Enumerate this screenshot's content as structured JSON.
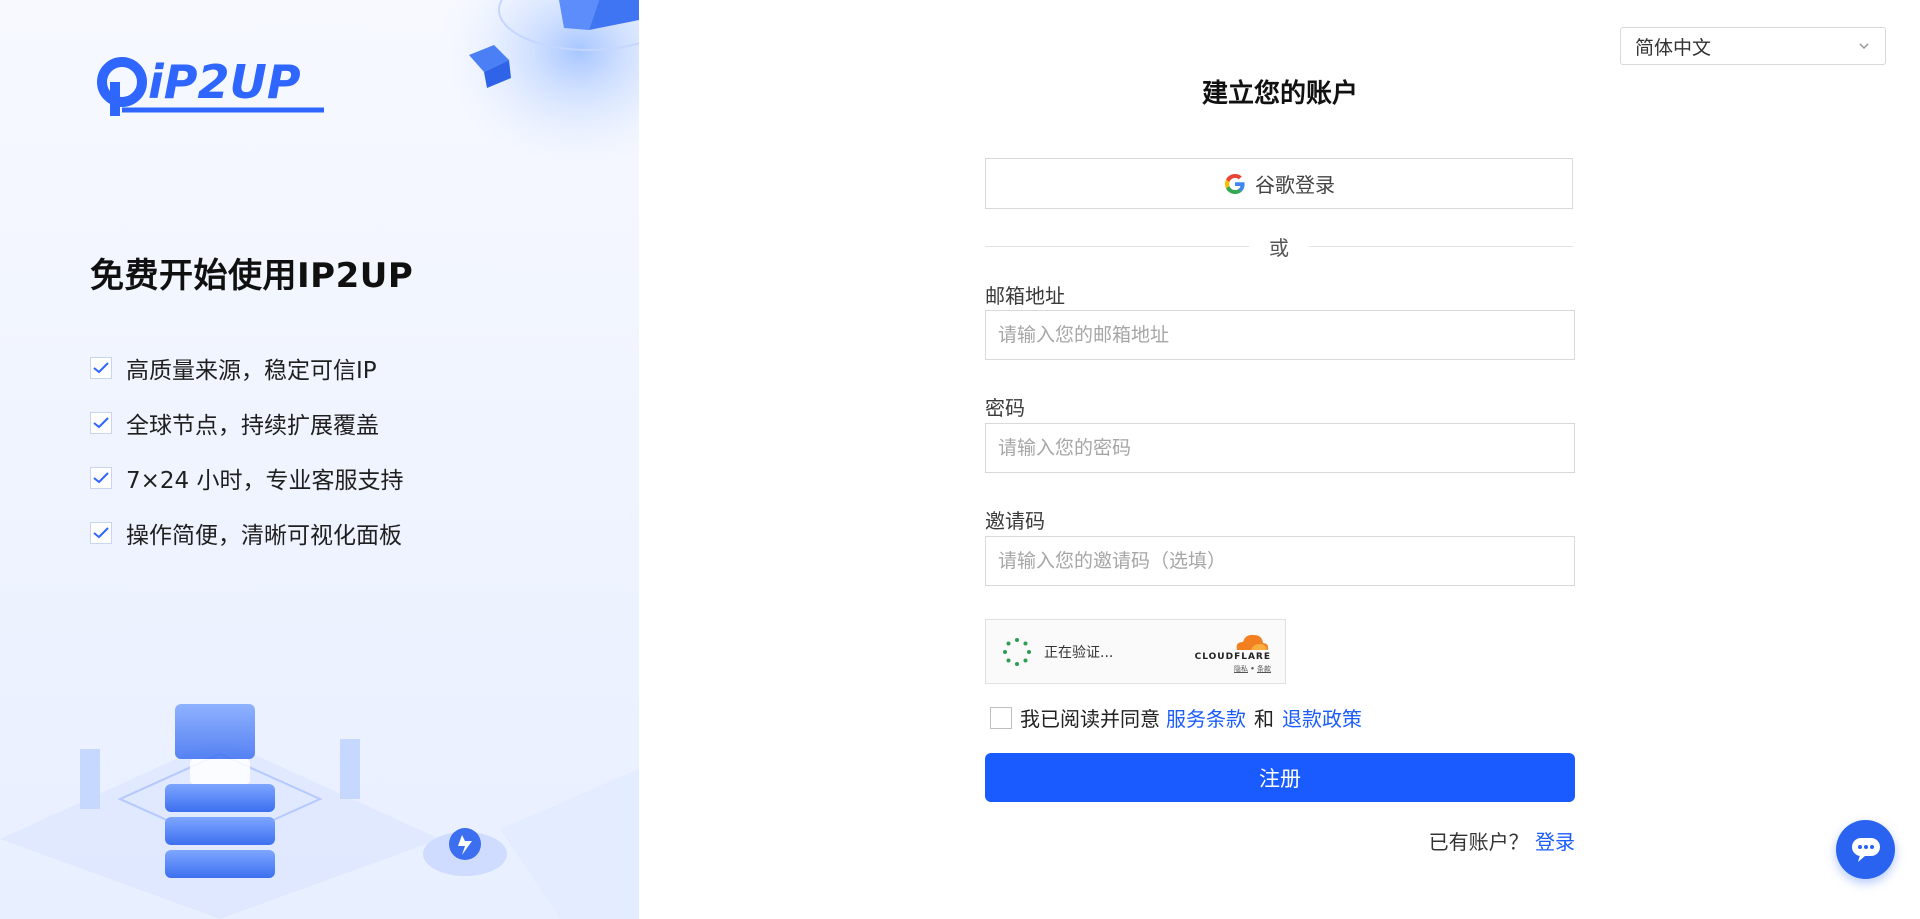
{
  "promo": {
    "logo_text": "iP2UP",
    "title": "免费开始使用IP2UP",
    "features": [
      "高质量来源，稳定可信IP",
      "全球节点，持续扩展覆盖",
      "7×24 小时，专业客服支持",
      "操作简便，清晰可视化面板"
    ]
  },
  "language": {
    "selected": "简体中文"
  },
  "form": {
    "title": "建立您的账户",
    "google_label": "谷歌登录",
    "divider": "或",
    "email": {
      "label": "邮箱地址",
      "value": "",
      "placeholder": "请输入您的邮箱地址"
    },
    "password": {
      "label": "密码",
      "value": "",
      "placeholder": "请输入您的密码"
    },
    "invite": {
      "label": "邀请码",
      "value": "",
      "placeholder": "请输入您的邀请码（选填）"
    },
    "captcha": {
      "status": "正在验证...",
      "provider": "CLOUDFLARE",
      "privacy": "隐私",
      "sep": "•",
      "terms": "条款"
    },
    "agree": {
      "prefix": "我已阅读并同意",
      "terms_link": "服务条款",
      "and": "和",
      "refund_link": "退款政策"
    },
    "submit": "注册",
    "login_prompt": "已有账户？",
    "login_link": "登录"
  },
  "colors": {
    "accent": "#1a5bff",
    "chat": "#2a63f0",
    "logo": "#2f66ff"
  },
  "icons": {
    "check": "check-icon",
    "google": "google-icon",
    "chevron": "chevron-down-icon",
    "chat": "chat-icon",
    "cloudflare": "cloudflare-icon"
  }
}
